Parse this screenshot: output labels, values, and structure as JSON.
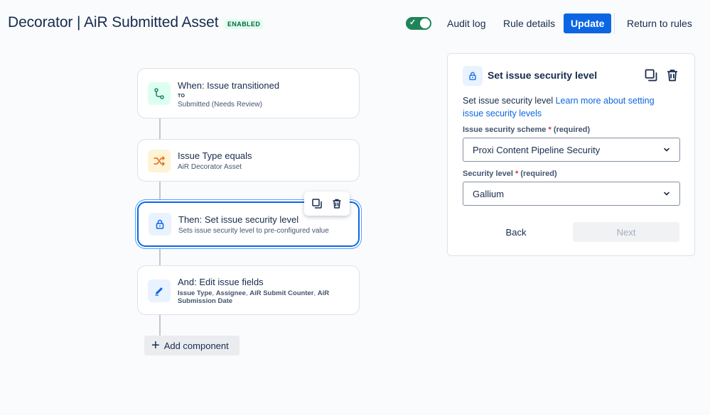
{
  "header": {
    "title": "Decorator | AiR Submitted Asset",
    "status": "ENABLED",
    "toggle_on": true,
    "audit_log": "Audit log",
    "rule_details": "Rule details",
    "update": "Update",
    "return_to_rules": "Return to rules"
  },
  "flow": {
    "trigger": {
      "title": "When: Issue transitioned",
      "to_label": "TO",
      "subtitle": "Submitted (Needs Review)",
      "icon": "transition-icon"
    },
    "condition": {
      "title": "Issue Type equals",
      "subtitle": "AiR Decorator Asset",
      "icon": "shuffle-icon"
    },
    "action": {
      "title": "Then: Set issue security level",
      "subtitle": "Sets issue security level to pre-configured value",
      "icon": "lock-icon"
    },
    "edit": {
      "title": "And: Edit issue fields",
      "fields": [
        "Issue Type",
        "Assignee",
        "AiR Submit Counter",
        "AiR Submission Date"
      ],
      "sep1": ", ",
      "sep2": ", ",
      "sep3": ", ",
      "icon": "pencil-icon"
    },
    "add_component": "Add component"
  },
  "panel": {
    "title": "Set issue security level",
    "desc_text": "Set issue security level ",
    "desc_link": "Learn more about setting issue security levels",
    "scheme_label": "Issue security scheme",
    "scheme_required": "(required)",
    "scheme_value": "Proxi Content Pipeline Security",
    "level_label": "Security level",
    "level_required": "(required)",
    "level_value": "Gallium",
    "back": "Back",
    "next": "Next"
  },
  "colors": {
    "accent": "#0c66e4",
    "toggle": "#1f845a",
    "enabled_bg": "#e3fcef",
    "enabled_text": "#006644"
  }
}
